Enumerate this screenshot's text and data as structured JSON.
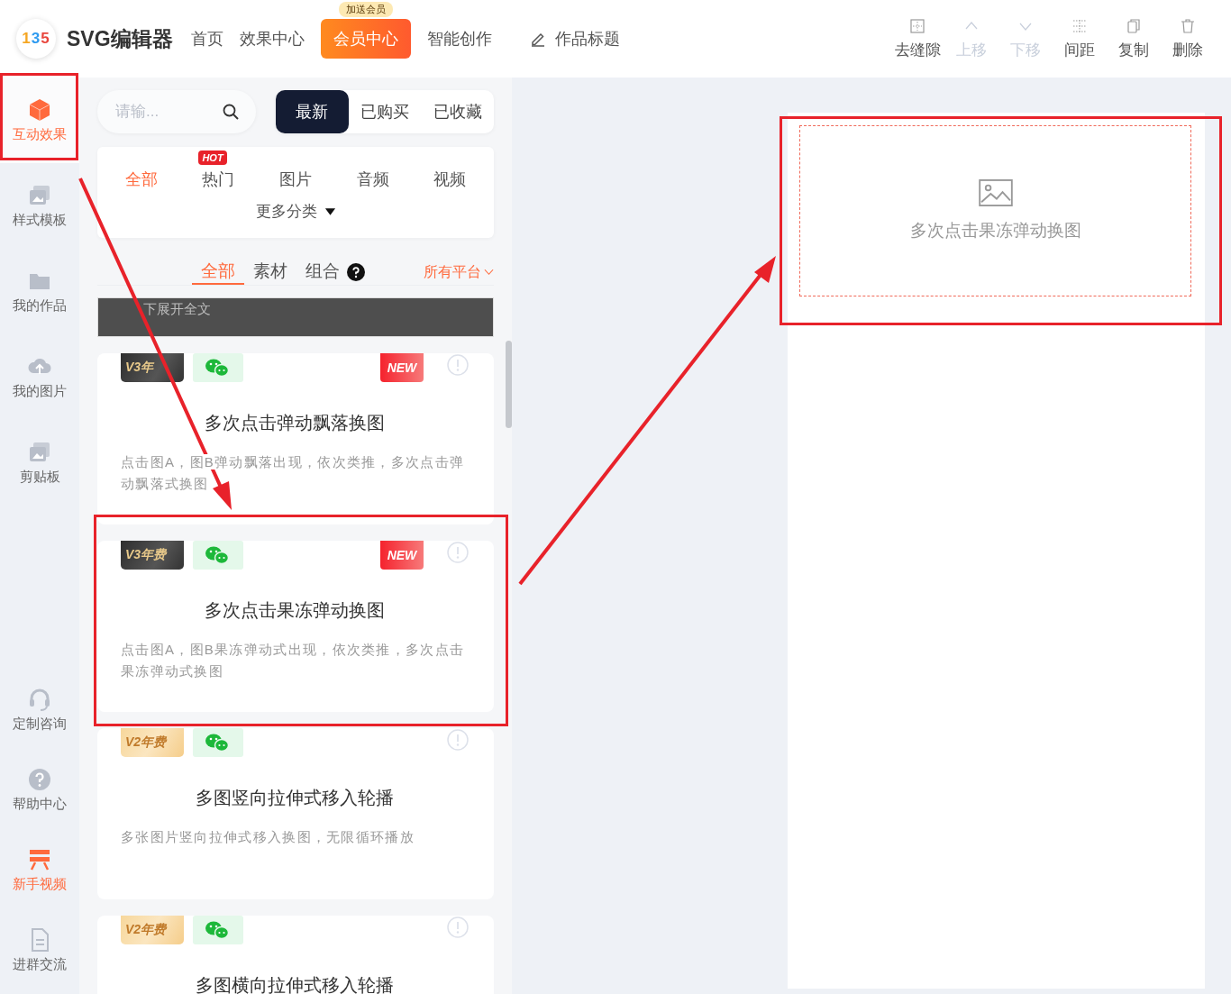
{
  "header": {
    "logo_text": "135",
    "app_name": "SVG编辑器",
    "nav": [
      {
        "label": "首页",
        "kind": "link"
      },
      {
        "label": "效果中心",
        "kind": "link"
      },
      {
        "label": "会员中心",
        "kind": "primary",
        "badge": "加送会员"
      },
      {
        "label": "智能创作",
        "kind": "link"
      }
    ],
    "title_field": {
      "value": "作品标题"
    },
    "toolbar": [
      {
        "label": "去缝隙",
        "disabled": false
      },
      {
        "label": "上移",
        "disabled": true
      },
      {
        "label": "下移",
        "disabled": true
      },
      {
        "label": "间距",
        "disabled": false
      },
      {
        "label": "复制",
        "disabled": false
      },
      {
        "label": "删除",
        "disabled": false
      }
    ]
  },
  "sidebar": {
    "top_items": [
      {
        "label": "互动效果",
        "selected": true,
        "highlighted": false
      },
      {
        "label": "样式模板",
        "selected": false,
        "highlighted": false
      },
      {
        "label": "我的作品",
        "selected": false,
        "highlighted": false
      },
      {
        "label": "我的图片",
        "selected": false,
        "highlighted": false
      },
      {
        "label": "剪贴板",
        "selected": false,
        "highlighted": false
      }
    ],
    "bottom_items": [
      {
        "label": "定制咨询",
        "selected": false,
        "highlighted": false
      },
      {
        "label": "帮助中心",
        "selected": false,
        "highlighted": false
      },
      {
        "label": "新手视频",
        "selected": false,
        "highlighted": true
      },
      {
        "label": "进群交流",
        "selected": false,
        "highlighted": false
      }
    ]
  },
  "panel": {
    "search": {
      "placeholder": "请输..."
    },
    "sort_tabs": [
      {
        "label": "最新",
        "selected": true
      },
      {
        "label": "已购买",
        "selected": false
      },
      {
        "label": "已收藏",
        "selected": false
      }
    ],
    "categories": [
      {
        "label": "全部",
        "selected": true
      },
      {
        "label": "热门",
        "selected": false,
        "badge": "HOT"
      },
      {
        "label": "图片",
        "selected": false
      },
      {
        "label": "音频",
        "selected": false
      },
      {
        "label": "视频",
        "selected": false
      }
    ],
    "more_categories": "更多分类",
    "type_tabs": [
      {
        "label": "全部",
        "selected": true,
        "help": false
      },
      {
        "label": "素材",
        "selected": false,
        "help": false
      },
      {
        "label": "组合",
        "selected": false,
        "help": true
      }
    ],
    "platform_filter": "所有平台",
    "notice": "下展开全文",
    "cards": [
      {
        "tier": "V3年",
        "kind": "v3",
        "new_badge": "NEW",
        "title": "多次点击弹动飘落换图",
        "description": "点击图A，图B弹动飘落出现，依次类推，多次点击弹动飘落式换图"
      },
      {
        "tier": "V3年费",
        "kind": "v3",
        "new_badge": "NEW",
        "title": "多次点击果冻弹动换图",
        "description": "点击图A，图B果冻弹动式出现，依次类推，多次点击果冻弹动式换图"
      },
      {
        "tier": "V2年费",
        "kind": "v2",
        "title": "多图竖向拉伸式移入轮播",
        "description": "多张图片竖向拉伸式移入换图，无限循环播放"
      },
      {
        "tier": "V2年费",
        "kind": "v2",
        "title": "多图横向拉伸式移入轮播"
      }
    ]
  },
  "canvas": {
    "placeholder": {
      "text": "多次点击果冻弹动换图"
    }
  }
}
